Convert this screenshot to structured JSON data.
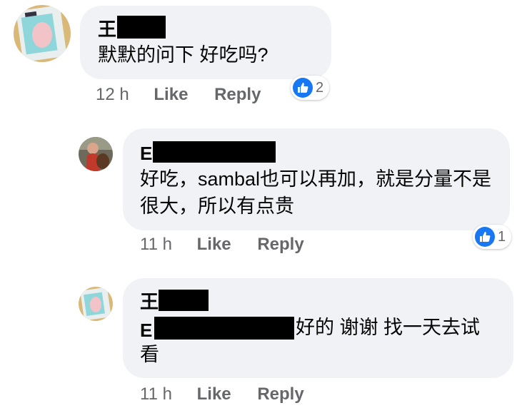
{
  "colors": {
    "bubble": "#f0f2f5",
    "meta_text": "#65676b",
    "like_blue": "#1877f2"
  },
  "icons": {
    "reaction": "thumbs-up-icon"
  },
  "comments": [
    {
      "name": "王",
      "text": "默默的问下 好吃吗?",
      "time": "12 h",
      "like_label": "Like",
      "reply_label": "Reply",
      "reaction_count": "2"
    },
    {
      "name": "E",
      "text": "好吃，sambal也可以再加，就是分量不是很大，所以有点贵",
      "time": "11 h",
      "like_label": "Like",
      "reply_label": "Reply",
      "reaction_count": "1"
    },
    {
      "name": "王",
      "mention": "E",
      "text": "好的 谢谢 找一天去试看",
      "time": "11 h",
      "like_label": "Like",
      "reply_label": "Reply"
    }
  ]
}
